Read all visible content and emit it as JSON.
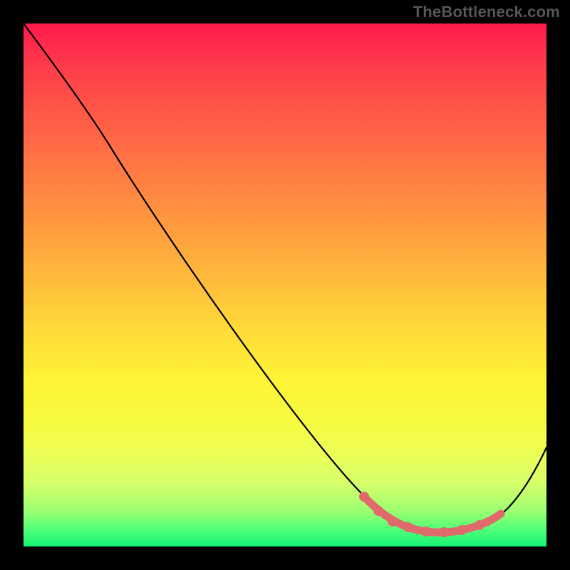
{
  "attribution": "TheBottleneck.com",
  "colors": {
    "background": "#000000",
    "gradient_top": "#ff1a4c",
    "gradient_bottom": "#14f376",
    "curve": "#000000",
    "highlight": "#e06a6b",
    "attribution_text": "#565656"
  },
  "chart_data": {
    "type": "line",
    "title": "",
    "xlabel": "",
    "ylabel": "",
    "xlim": [
      0,
      100
    ],
    "ylim": [
      0,
      100
    ],
    "series": [
      {
        "name": "bottleneck-curve",
        "x": [
          0,
          8,
          16,
          25,
          35,
          45,
          55,
          64,
          70,
          75,
          80,
          85,
          90,
          95,
          100
        ],
        "y": [
          100,
          88,
          77,
          62,
          46,
          30,
          18,
          10,
          6,
          4,
          3,
          3,
          4,
          8,
          19
        ]
      }
    ],
    "highlight_region": {
      "x_range": [
        65,
        91
      ],
      "points": [
        {
          "x": 65,
          "y": 9.5
        },
        {
          "x": 68,
          "y": 6.8
        },
        {
          "x": 71,
          "y": 4.8
        },
        {
          "x": 74,
          "y": 3.7
        },
        {
          "x": 77,
          "y": 2.9
        },
        {
          "x": 80,
          "y": 2.7
        },
        {
          "x": 84,
          "y": 3.1
        },
        {
          "x": 87,
          "y": 4.1
        },
        {
          "x": 89,
          "y": 4.6
        },
        {
          "x": 91,
          "y": 5.9
        }
      ]
    },
    "background_heatmap": {
      "orientation": "vertical",
      "stops": [
        {
          "pos": 0.0,
          "color": "#ff1a4c"
        },
        {
          "pos": 0.28,
          "color": "#ff7a43"
        },
        {
          "pos": 0.58,
          "color": "#ffd939"
        },
        {
          "pos": 0.82,
          "color": "#eefe55"
        },
        {
          "pos": 1.0,
          "color": "#14f376"
        }
      ]
    }
  }
}
